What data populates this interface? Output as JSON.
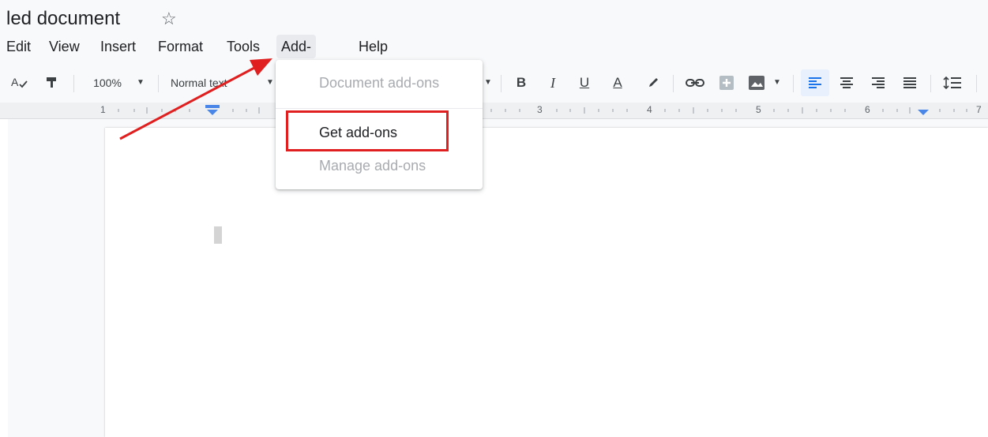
{
  "document": {
    "title": "led document"
  },
  "menubar": {
    "items": [
      "Edit",
      "View",
      "Insert",
      "Format",
      "Tools",
      "Add-ons",
      "Help"
    ],
    "active": "Add-ons"
  },
  "toolbar": {
    "zoom": "100%",
    "style": "Normal text",
    "bold": "B",
    "italic": "I",
    "underline": "U",
    "text_color": "A"
  },
  "ruler": {
    "numbers": [
      "1",
      "3",
      "4",
      "5",
      "6",
      "7"
    ]
  },
  "addons_menu": {
    "header": "Document add-ons",
    "get_addons": "Get add-ons",
    "manage_addons": "Manage add-ons"
  },
  "colors": {
    "annotation": "#e02020",
    "accent": "#1a73e8"
  }
}
